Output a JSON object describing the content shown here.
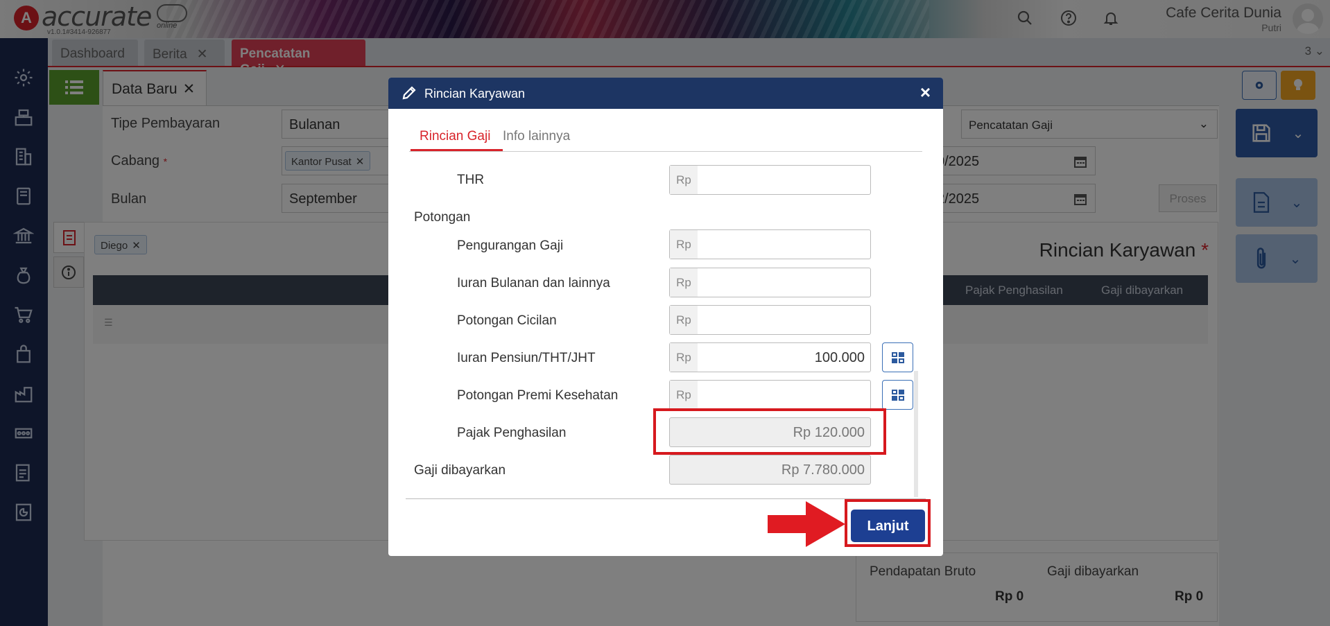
{
  "header": {
    "logo_text": "accurate",
    "logo_sub": "online",
    "version": "v1.0.1#3414-926877",
    "company": "Cafe Cerita Dunia",
    "user": "Putri"
  },
  "tabs": [
    {
      "label": "Dashboard"
    },
    {
      "label": "Berita"
    },
    {
      "label": "Pencatatan Gaji"
    }
  ],
  "tab_count": "3 ⌄",
  "subtab": {
    "label": "Data Baru"
  },
  "form": {
    "tipe_pembayaran_label": "Tipe Pembayaran",
    "tipe_pembayaran_value": "Bulanan",
    "cabang_label": "Cabang",
    "cabang_value": "Kantor Pusat",
    "bulan_label": "Bulan",
    "bulan_value": "September",
    "type_select": "Pencatatan Gaji",
    "date1": "0/2025",
    "date2": "2/2025",
    "proses": "Proses",
    "employee_chip": "Diego",
    "section_title": "Rincian Karyawan",
    "grid_col_pajak": "Pajak Penghasilan",
    "grid_col_gaji": "Gaji dibayarkan"
  },
  "summary": {
    "pendapatan_label": "Pendapatan Bruto",
    "pendapatan_value": "Rp 0",
    "gaji_label": "Gaji dibayarkan",
    "gaji_value": "Rp 0"
  },
  "modal": {
    "title": "Rincian Karyawan",
    "tabs": [
      {
        "label": "Rincian Gaji"
      },
      {
        "label": "Info lainnya"
      }
    ],
    "currency": "Rp",
    "rows": {
      "thr": {
        "label": "THR",
        "value": ""
      },
      "potongan_header": "Potongan",
      "pengurangan_gaji": {
        "label": "Pengurangan Gaji",
        "value": ""
      },
      "iuran_bulanan": {
        "label": "Iuran Bulanan dan lainnya",
        "value": ""
      },
      "potongan_cicilan": {
        "label": "Potongan Cicilan",
        "value": ""
      },
      "iuran_pensiun": {
        "label": "Iuran Pensiun/THT/JHT",
        "value": "100.000"
      },
      "potongan_premi": {
        "label": "Potongan Premi Kesehatan",
        "value": ""
      },
      "pajak_penghasilan": {
        "label": "Pajak Penghasilan",
        "value": "Rp 120.000"
      },
      "gaji_dibayarkan": {
        "label": "Gaji dibayarkan",
        "value": "Rp 7.780.000"
      }
    },
    "submit_label": "Lanjut"
  },
  "colors": {
    "brand_red": "#d8232a",
    "navy": "#1d3563",
    "submit_blue": "#1d3f92",
    "highlight_red": "#d6191e"
  }
}
